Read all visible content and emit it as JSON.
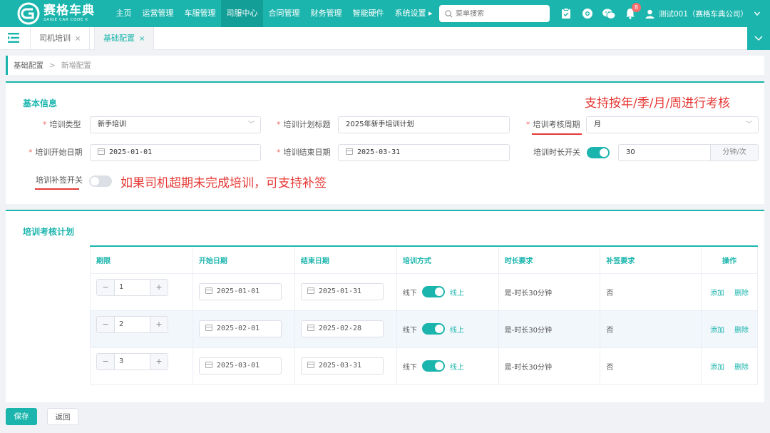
{
  "app": {
    "logo_cn": "赛格车典",
    "logo_en": "SAIGE CAR CODE X"
  },
  "nav": {
    "items": [
      "主页",
      "运营管理",
      "车服管理",
      "司服中心",
      "合同管理",
      "财务管理",
      "智能硬件",
      "系统设置 ▸"
    ],
    "active_index": 3
  },
  "search": {
    "placeholder": "菜单搜索"
  },
  "notifications": {
    "count": "8"
  },
  "user": {
    "name": "测试001（赛格车典公司）"
  },
  "tabs": [
    {
      "label": "司机培训",
      "close": "×",
      "active": false
    },
    {
      "label": "基础配置",
      "close": "×",
      "active": true
    }
  ],
  "breadcrumb": {
    "parent": "基础配置",
    "separator": ">",
    "current": "新增配置"
  },
  "basic_info": {
    "title": "基本信息",
    "annotation_period": "支持按年/季/月/周进行考核",
    "annotation_makeup": "如果司机超期未完成培训，可支持补签",
    "fields": {
      "training_type": {
        "label": "培训类型",
        "value": "新手培训"
      },
      "plan_title": {
        "label": "培训计划标题",
        "value": "2025年新手培训计划"
      },
      "assessment_period": {
        "label": "培训考核周期",
        "value": "月"
      },
      "start_date": {
        "label": "培训开始日期",
        "value": "2025-01-01"
      },
      "end_date": {
        "label": "培训结束日期",
        "value": "2025-03-31"
      },
      "duration_switch": {
        "label": "培训时长开关",
        "on": true,
        "value": "30",
        "unit": "分钟/次"
      },
      "makeup_switch": {
        "label": "培训补签开关",
        "on": false
      }
    },
    "required_mark": "*"
  },
  "plan": {
    "title": "培训考核计划",
    "columns": [
      "期限",
      "开始日期",
      "结束日期",
      "培训方式",
      "时长要求",
      "补签要求",
      "操作"
    ],
    "rows": [
      {
        "period": "1",
        "start": "2025-01-01",
        "end": "2025-01-31",
        "mode_off": "线下",
        "mode_on": "线上",
        "duration": "是-时长30分钟",
        "makeup": "否",
        "add": "添加",
        "del": "删除"
      },
      {
        "period": "2",
        "start": "2025-02-01",
        "end": "2025-02-28",
        "mode_off": "线下",
        "mode_on": "线上",
        "duration": "是-时长30分钟",
        "makeup": "否",
        "add": "添加",
        "del": "删除"
      },
      {
        "period": "3",
        "start": "2025-03-01",
        "end": "2025-03-31",
        "mode_off": "线下",
        "mode_on": "线上",
        "duration": "是-时长30分钟",
        "makeup": "否",
        "add": "添加",
        "del": "删除"
      }
    ],
    "stepper": {
      "minus": "−",
      "plus": "+"
    }
  },
  "actions": {
    "save": "保存",
    "back": "返回"
  },
  "colors": {
    "primary": "#1bb5ad",
    "annotation": "#e53935",
    "badge": "#f56c6c"
  }
}
